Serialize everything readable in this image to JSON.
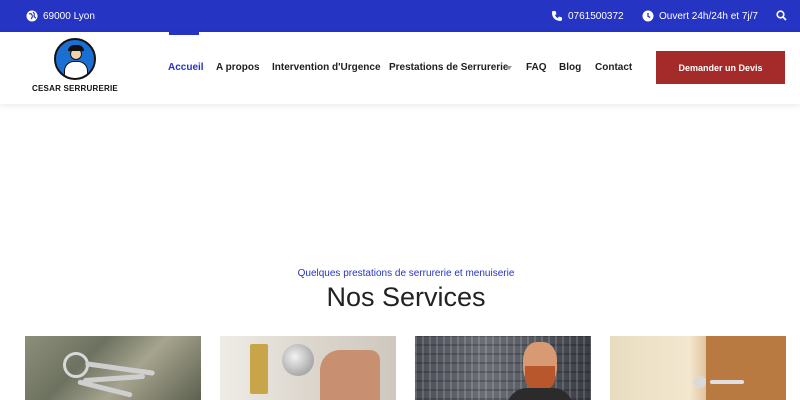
{
  "topbar": {
    "location": "69000 Lyon",
    "phone": "0761500372",
    "hours": "Ouvert 24h/24h et 7j/7"
  },
  "header": {
    "logo_text": "CESAR SERRURERIE",
    "nav": [
      {
        "label": "Accueil",
        "active": true
      },
      {
        "label": "A propos"
      },
      {
        "label": "Intervention d'Urgence"
      },
      {
        "label": "Prestations de Serrurerie",
        "has_dropdown": true
      },
      {
        "label": "FAQ"
      },
      {
        "label": "Blog"
      },
      {
        "label": "Contact"
      }
    ],
    "cta_label": "Demander un Devis"
  },
  "services": {
    "subtitle": "Quelques prestations de serrurerie et menuiserie",
    "title": "Nos Services"
  },
  "colors": {
    "brand_blue": "#2634c4",
    "cta_red": "#a52a2a"
  }
}
